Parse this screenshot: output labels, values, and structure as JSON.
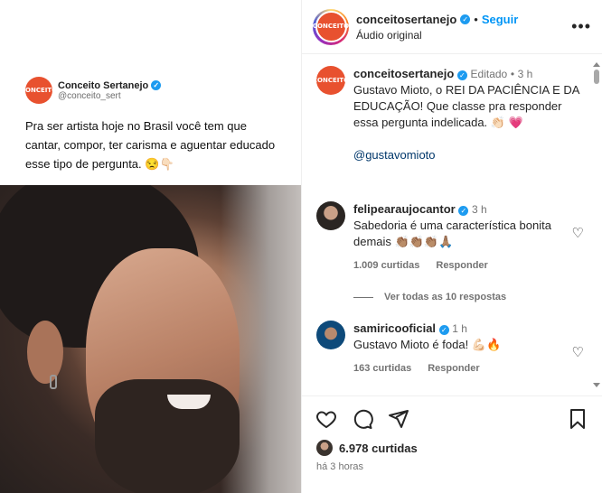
{
  "media": {
    "tweet": {
      "avatar_text": "CONCEITO",
      "name": "Conceito Sertanejo",
      "handle": "@conceito_sert",
      "text": "Pra ser artista hoje no Brasil você tem que cantar, compor, ter carisma e aguentar educado esse tipo de pergunta. 😒👇🏻"
    }
  },
  "header": {
    "avatar_text": "CONCEITO",
    "username": "conceitosertanejo",
    "dot": "•",
    "follow_label": "Seguir",
    "subtitle": "Áudio original",
    "more": "•••"
  },
  "caption": {
    "username": "conceitosertanejo",
    "edited": "Editado",
    "dot": "•",
    "time": "3 h",
    "text": "Gustavo Mioto, o REI DA PACIÊNCIA E DA EDUCAÇÃO! Que classe pra responder essa pergunta indelicada. 👏🏻 💗",
    "mention": "@gustavomioto"
  },
  "comments": [
    {
      "username": "felipearaujocantor",
      "time": "3 h",
      "text": "Sabedoria é uma característica bonita demais 👏🏽👏🏽👏🏽🙏🏽",
      "likes": "1.009 curtidas",
      "reply": "Responder"
    },
    {
      "username": "samiricooficial",
      "time": "1 h",
      "text": "Gustavo Mioto é foda! 💪🏻🔥",
      "likes": "163 curtidas",
      "reply": "Responder"
    }
  ],
  "view_replies": "Ver todas as 10 respostas",
  "footer": {
    "likes": "6.978 curtidas",
    "time": "há 3 horas"
  },
  "colors": {
    "accent": "#0095f6",
    "brand": "#e8512f",
    "verified": "#0095f6"
  },
  "icons": [
    "heart-icon",
    "comment-icon",
    "share-icon",
    "bookmark-icon",
    "verified-icon",
    "more-options-icon"
  ]
}
